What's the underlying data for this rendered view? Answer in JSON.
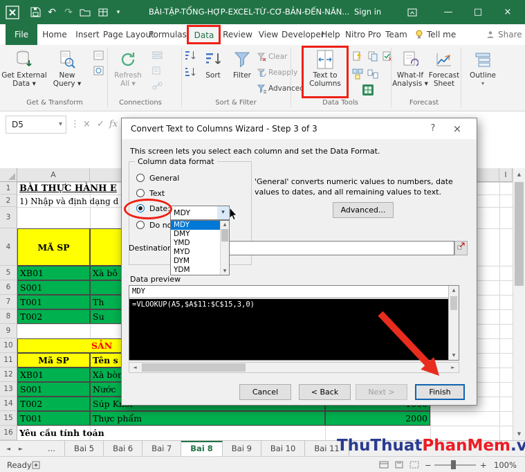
{
  "titlebar": {
    "title": "BÀI-TẬP-TỔNG-HỢP-EXCEL-TỪ-CƠ-BẢN-ĐẾN-NÂN...",
    "sign_in": "Sign in"
  },
  "glyphs": {
    "undo": "↶",
    "redo": "↷",
    "caret": "▾",
    "dots": "⋮",
    "close": "×",
    "check": "✓",
    "fx": "fx",
    "minimize": "—",
    "maximize": "□",
    "help": "?",
    "up": "▲",
    "down": "▼",
    "left": "◄",
    "right": "►",
    "minus": "−",
    "plus": "+"
  },
  "ribbon_tabs": {
    "file": "File",
    "home": "Home",
    "insert": "Insert",
    "page_layout": "Page Layout",
    "formulas": "Formulas",
    "data": "Data",
    "review": "Review",
    "view": "View",
    "developer": "Developer",
    "help": "Help",
    "nitro_pro": "Nitro Pro",
    "team": "Team",
    "tell_me": "Tell me",
    "share": "Share"
  },
  "ribbon": {
    "get_external_1": "Get External",
    "get_external_2": "Data ▾",
    "new_query_1": "New",
    "new_query_2": "Query ▾",
    "refresh_1": "Refresh",
    "refresh_2": "All ▾",
    "sort": "Sort",
    "filter": "Filter",
    "clear": "Clear",
    "reapply": "Reapply",
    "advanced": "Advanced",
    "ttc_1": "Text to",
    "ttc_2": "Columns",
    "whatif_1": "What-If",
    "whatif_2": "Analysis ▾",
    "forecast_1": "Forecast",
    "forecast_2": "Sheet",
    "outline": "Outline",
    "groups": {
      "get_transform": "Get & Transform",
      "connections": "Connections",
      "sort_filter": "Sort & Filter",
      "data_tools": "Data Tools",
      "forecast": "Forecast"
    }
  },
  "formula_bar": {
    "name_box": "D5"
  },
  "dialog": {
    "title": "Convert Text to Columns Wizard - Step 3 of 3",
    "intro": "This screen lets you select each column and set the Data Format.",
    "group_label": "Column data format",
    "radio_general": "General",
    "radio_text": "Text",
    "radio_date": "Date:",
    "radio_skip": "Do not",
    "date_value": "MDY",
    "date_options": [
      "MDY",
      "DMY",
      "YMD",
      "MYD",
      "DYM",
      "YDM"
    ],
    "hint": "'General' converts numeric values to numbers, date values to dates, and all remaining values to text.",
    "advanced_btn": "Advanced...",
    "destination": "Destination:",
    "preview_label": "Data preview",
    "preview_format": "MDY",
    "preview_text": "=VLOOKUP(A5,$A$11:$C$15,3,0)",
    "cancel": "Cancel",
    "back": "< Back",
    "next": "Next >",
    "finish": "Finish"
  },
  "sheet": {
    "col_a": "A",
    "col_i": "I",
    "row_numbers": [
      "1",
      "2",
      "3",
      "4",
      "5",
      "6",
      "7",
      "8",
      "9",
      "10",
      "11",
      "12",
      "13",
      "14",
      "15",
      "16"
    ],
    "cells": {
      "r1a": "BÀI THỰC HÀNH E",
      "r2a": "1) Nhập và định dạng d",
      "r4a": "MÃ SP",
      "r5a": "XB01",
      "r5b": "Xà bô",
      "r6a": "S001",
      "r7a": "T001",
      "r7b": "Th",
      "r8a": "T002",
      "r8b": "Su",
      "r10": "SẢN",
      "r11a": "Mã SP",
      "r11b": "Tên s",
      "r12a": "XB01",
      "r12b": "Xà bòn",
      "r13a": "S001",
      "r13b": "Nước",
      "r14a": "T002",
      "r14b": "Súp Knor",
      "r14c": "1000",
      "r15a": "T001",
      "r15b": "Thực phẩm",
      "r15c": "2000",
      "r16a": "Yêu cầu tính toán"
    }
  },
  "sheet_tabs": {
    "items": [
      "...",
      "Bai 5",
      "Bai 6",
      "Bai 7",
      "Bai 8",
      "Bai 9",
      "Bai 10",
      "Bai 11"
    ],
    "active_index": 4
  },
  "watermark": {
    "p1": "ThuThuat",
    "p2": "PhanMem",
    "p3": ".vn"
  },
  "status": {
    "ready": "Ready",
    "zoom": "100%"
  }
}
